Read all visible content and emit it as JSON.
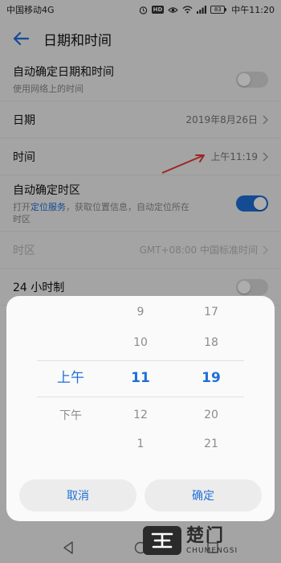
{
  "status_bar": {
    "carrier": "中国移动4G",
    "hd_badge": "HD",
    "battery": "83",
    "time": "中午11:20",
    "icons": [
      "alarm-icon",
      "eye-icon",
      "wifi-icon",
      "signal-icon",
      "battery-icon"
    ]
  },
  "header": {
    "title": "日期和时间",
    "back_icon": "arrow-left-icon"
  },
  "settings": {
    "auto_datetime": {
      "title": "自动确定日期和时间",
      "subtitle": "使用网络上的时间",
      "toggle": "off"
    },
    "date": {
      "title": "日期",
      "value": "2019年8月26日"
    },
    "time": {
      "title": "时间",
      "value": "上午11:19"
    },
    "auto_timezone": {
      "title": "自动确定时区",
      "subtitle_prefix": "打开",
      "subtitle_link": "定位服务",
      "subtitle_rest": "，获取位置信息，自动定位所在",
      "subtitle_line2": "时区",
      "toggle": "on"
    },
    "timezone": {
      "title": "时区",
      "value": "GMT+08:00 中国标准时间"
    },
    "hour24": {
      "title": "24 小时制",
      "toggle": "off"
    }
  },
  "picker": {
    "ampm": {
      "items": [
        "上午",
        "下午"
      ],
      "selected": "上午"
    },
    "hours": {
      "items": [
        "9",
        "10",
        "11",
        "12",
        "1"
      ],
      "selected": "11"
    },
    "minutes": {
      "items": [
        "17",
        "18",
        "19",
        "20",
        "21"
      ],
      "selected": "19"
    },
    "cancel_label": "取消",
    "confirm_label": "确定"
  },
  "nav_bar": {
    "icons": [
      "nav-back-icon",
      "nav-home-icon",
      "nav-recents-icon"
    ]
  },
  "watermark": {
    "cn": "楚门",
    "en": "CHUMENGSI"
  },
  "colors": {
    "accent": "#1e6fd9",
    "annotation_arrow": "#e53935",
    "dialog_bg": "#fafafa"
  }
}
